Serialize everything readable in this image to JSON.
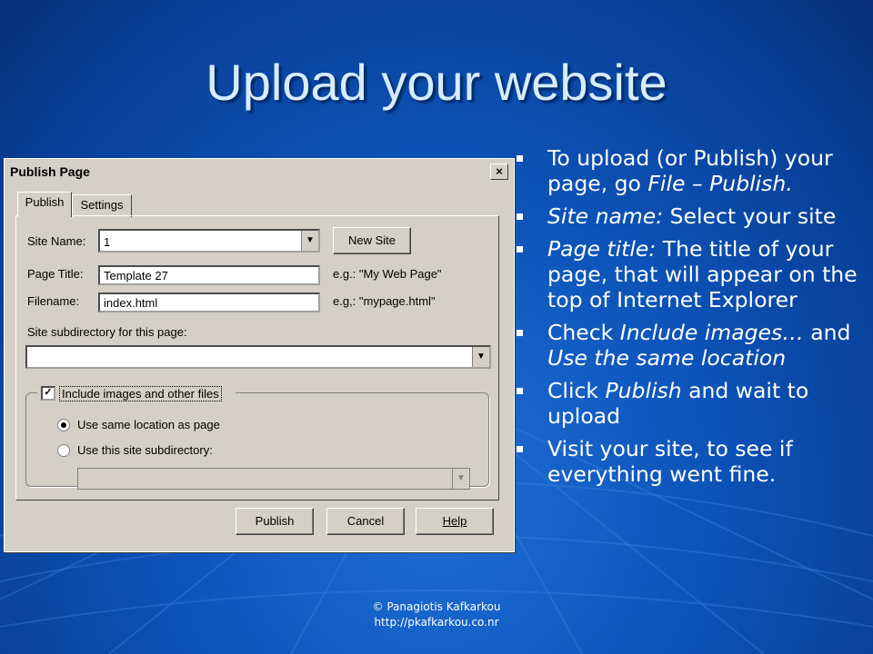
{
  "slide": {
    "title": "Upload your website",
    "footer_line1": "© Panagiotis Kafkarkou",
    "footer_line2": "http://pkafkarkou.co.nr"
  },
  "dialog": {
    "title": "Publish Page",
    "close_glyph": "×",
    "tabs": [
      {
        "label": "Publish",
        "active": true
      },
      {
        "label": "Settings",
        "active": false
      }
    ],
    "site_name_label": "Site Name:",
    "site_name_value": "1",
    "new_site_button": "New Site",
    "page_title_label": "Page Title:",
    "page_title_value": "Template 27",
    "page_title_hint": "e.g.: \"My Web Page\"",
    "filename_label": "Filename:",
    "filename_value": "index.html",
    "filename_hint": "e.g,: \"mypage.html\"",
    "subdir_label": "Site subdirectory for this page:",
    "subdir_value": "",
    "include_images_label": "Include images and other files",
    "include_images_checked": true,
    "radio_same_location": "Use same location as page",
    "radio_subdirectory": "Use this site subdirectory:",
    "selected_radio": "same_location",
    "publish_button": "Publish",
    "cancel_button": "Cancel",
    "help_button": "Help",
    "dropdown_glyph": "▼"
  },
  "bullets": [
    {
      "parts": [
        {
          "t": "To upload (or Publish) your page, go ",
          "i": false
        },
        {
          "t": "File – Publish.",
          "i": true
        }
      ]
    },
    {
      "parts": [
        {
          "t": "Site name:",
          "i": true
        },
        {
          "t": " Select your site",
          "i": false
        }
      ]
    },
    {
      "parts": [
        {
          "t": "Page title:",
          "i": true
        },
        {
          "t": " The title of your page, that will appear on the top of Internet Explorer",
          "i": false
        }
      ]
    },
    {
      "parts": [
        {
          "t": "Check ",
          "i": false
        },
        {
          "t": "Include images…",
          "i": true
        },
        {
          "t": " and ",
          "i": false
        },
        {
          "t": "Use the same location",
          "i": true
        }
      ]
    },
    {
      "parts": [
        {
          "t": "Click ",
          "i": false
        },
        {
          "t": "Publish",
          "i": true
        },
        {
          "t": " and wait to upload",
          "i": false
        }
      ]
    },
    {
      "parts": [
        {
          "t": "Visit your site, to see if everything went fine.",
          "i": false
        }
      ]
    }
  ],
  "colors": {
    "background": "#0d53b8",
    "title_text": "#d8ecff",
    "dialog_face": "#d4d0c8"
  }
}
